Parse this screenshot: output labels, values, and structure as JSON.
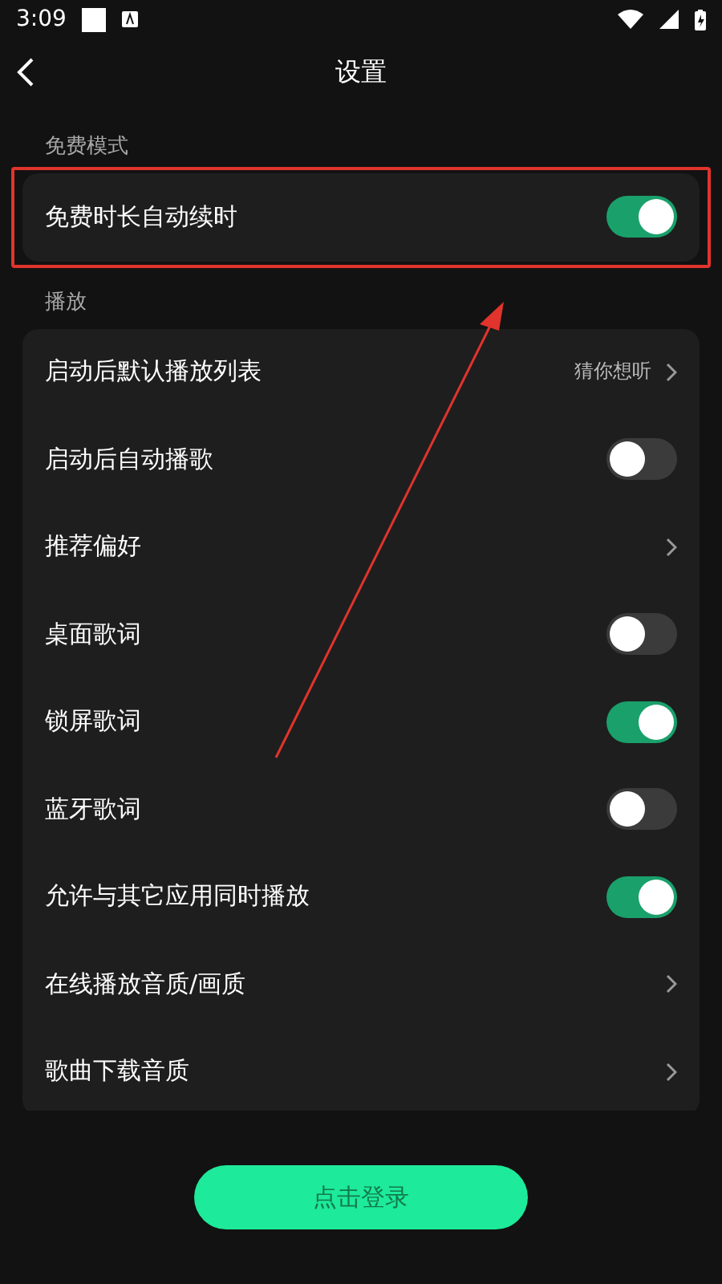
{
  "status_bar": {
    "time": "3:09"
  },
  "header": {
    "title": "设置"
  },
  "sections": [
    {
      "title": "免费模式",
      "rows": [
        {
          "kind": "toggle",
          "label": "免费时长自动续时",
          "on": true
        }
      ]
    },
    {
      "title": "播放",
      "rows": [
        {
          "kind": "link",
          "label": "启动后默认播放列表",
          "value": "猜你想听"
        },
        {
          "kind": "toggle",
          "label": "启动后自动播歌",
          "on": false
        },
        {
          "kind": "link",
          "label": "推荐偏好"
        },
        {
          "kind": "toggle",
          "label": "桌面歌词",
          "on": false
        },
        {
          "kind": "toggle",
          "label": "锁屏歌词",
          "on": true
        },
        {
          "kind": "toggle",
          "label": "蓝牙歌词",
          "on": false
        },
        {
          "kind": "toggle",
          "label": "允许与其它应用同时播放",
          "on": true
        },
        {
          "kind": "link",
          "label": "在线播放音质/画质"
        },
        {
          "kind": "link",
          "label": "歌曲下载音质"
        }
      ]
    }
  ],
  "login_button": {
    "label": "点击登录"
  }
}
